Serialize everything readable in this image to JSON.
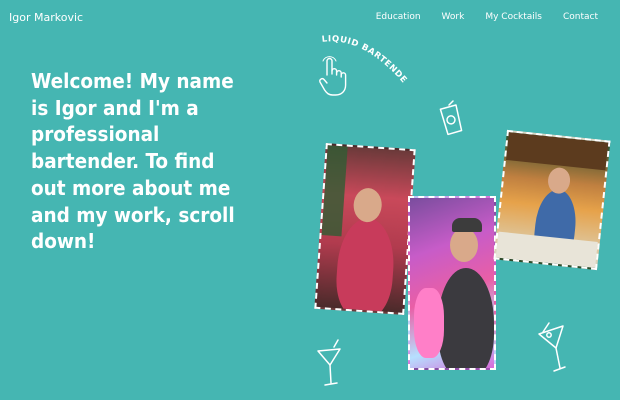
{
  "header": {
    "brand": "Igor Markovic",
    "nav": [
      {
        "label": "Education"
      },
      {
        "label": "Work"
      },
      {
        "label": "My Cocktails"
      },
      {
        "label": "Contact"
      }
    ]
  },
  "hero": {
    "text": "Welcome! My name is Igor and I'm a professional bartender. To find out more about me and my work, scroll down!"
  },
  "logo": {
    "text": "LIQUID BARTENDER"
  },
  "colors": {
    "background": "#45b6b2",
    "text": "#ffffff"
  },
  "icons": [
    "tap-hand-icon",
    "drink-glass-icon",
    "martini-icon"
  ]
}
